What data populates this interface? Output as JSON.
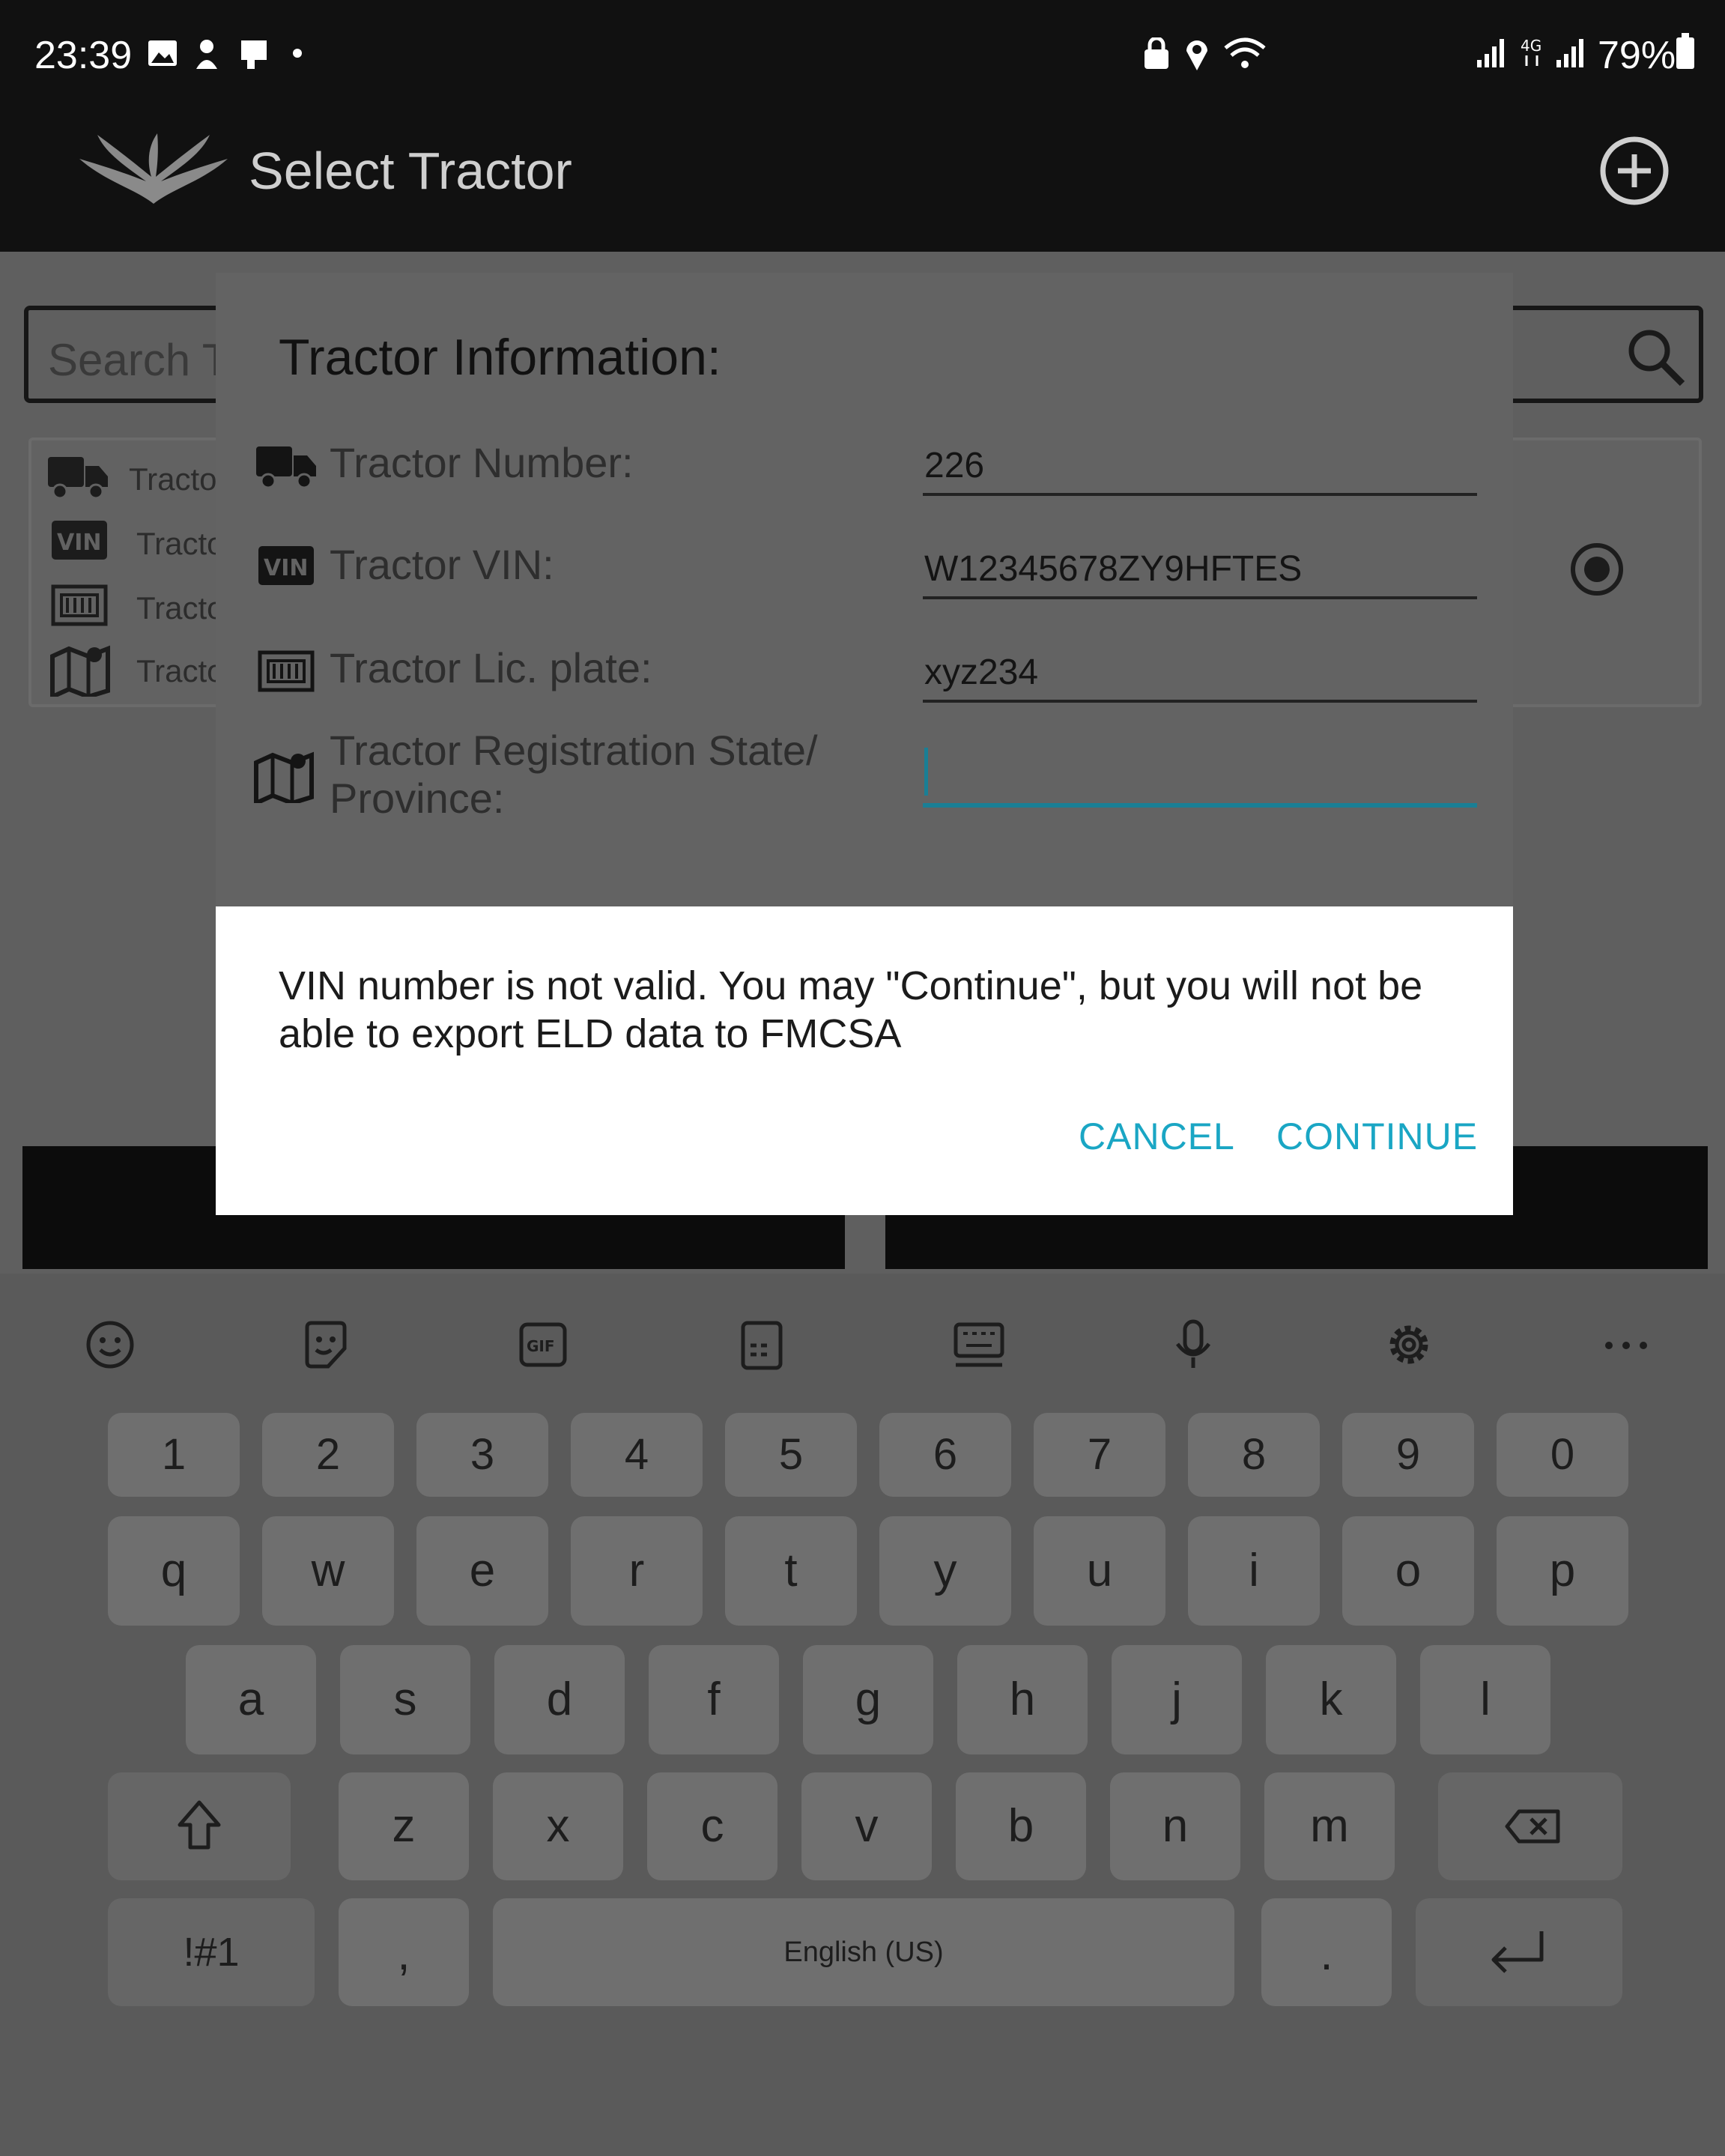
{
  "status_bar": {
    "time": "23:39",
    "battery": "79%"
  },
  "app_bar": {
    "title": "Select Tractor"
  },
  "search": {
    "placeholder": "Search T"
  },
  "list_card": {
    "rows": [
      "Tractor",
      "Tractor",
      "Tractor",
      "Tractor"
    ]
  },
  "tractor_info": {
    "title": "Tractor Information:",
    "fields": [
      {
        "label": "Tractor Number:",
        "value": "226"
      },
      {
        "label": "Tractor VIN:",
        "value": "W12345678ZY9HFTES"
      },
      {
        "label": "Tractor Lic. plate:",
        "value": "xyz234"
      },
      {
        "label_line1": "Tractor Registration State/",
        "label_line2": "Province:",
        "value": ""
      }
    ]
  },
  "alert": {
    "message": "VIN number is not valid. You may \"Continue\", but you will not be able to export ELD data to FMCSA",
    "cancel_label": "CANCEL",
    "continue_label": "CONTINUE",
    "button_color": "#1aa6c4"
  },
  "keyboard": {
    "row_numbers": [
      "1",
      "2",
      "3",
      "4",
      "5",
      "6",
      "7",
      "8",
      "9",
      "0"
    ],
    "row_q": [
      "q",
      "w",
      "e",
      "r",
      "t",
      "y",
      "u",
      "i",
      "o",
      "p"
    ],
    "row_a": [
      "a",
      "s",
      "d",
      "f",
      "g",
      "h",
      "j",
      "k",
      "l"
    ],
    "row_z": [
      "z",
      "x",
      "c",
      "v",
      "b",
      "n",
      "m"
    ],
    "symbols_label": "!#1",
    "comma_label": ",",
    "space_label": "English (US)",
    "period_label": "."
  }
}
